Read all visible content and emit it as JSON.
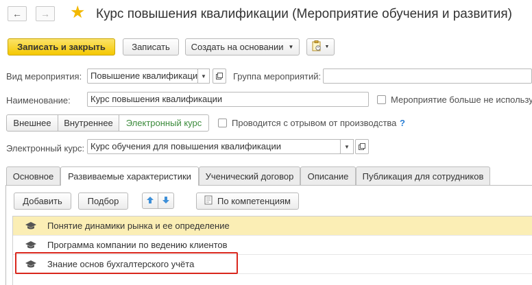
{
  "window": {
    "title": "Курс повышения квалификации (Мероприятие обучения и развития)"
  },
  "toolbar": {
    "save_close": "Записать и закрыть",
    "save": "Записать",
    "create_based_on": "Создать на основании"
  },
  "form": {
    "event_type_label": "Вид мероприятия:",
    "event_type_value": "Повышение квалификаци",
    "event_group_label": "Группа мероприятий:",
    "event_group_value": "",
    "name_label": "Наименование:",
    "name_value": "Курс повышения квалификации",
    "not_used_label": "Мероприятие больше не использу",
    "kind_options": [
      "Внешнее",
      "Внутреннее",
      "Электронный курс"
    ],
    "kind_selected": "Электронный курс",
    "off_work_label": "Проводится с отрывом от производства",
    "help_mark": "?",
    "ecourse_label": "Электронный курс:",
    "ecourse_value": "Курс обучения для повышения квалификации"
  },
  "tabs": [
    {
      "label": "Основное"
    },
    {
      "label": "Развиваемые характеристики",
      "active": true
    },
    {
      "label": "Ученический договор"
    },
    {
      "label": "Описание"
    },
    {
      "label": "Публикация для сотрудников"
    }
  ],
  "tab_toolbar": {
    "add": "Добавить",
    "select": "Подбор",
    "by_competencies": "По компетенциям"
  },
  "characteristics": [
    {
      "text": "Понятие динамики рынка и ее определение",
      "selected": true
    },
    {
      "text": "Программа компании по ведению клиентов",
      "selected": false
    },
    {
      "text": "Знание основ бухгалтерского учёта",
      "selected": false,
      "highlighted": true
    }
  ],
  "colors": {
    "accent": "#f5c800",
    "highlight_border": "#d9261c",
    "selected_row": "#fbeeb5",
    "active_segment_text": "#3a8a3a",
    "help_mark": "#2a7fd4"
  },
  "icons": [
    "back-arrow-icon",
    "forward-arrow-icon",
    "favorite-star-icon",
    "report-icon",
    "open-icon",
    "arrow-up-icon",
    "arrow-down-icon",
    "graduation-cap-icon"
  ]
}
